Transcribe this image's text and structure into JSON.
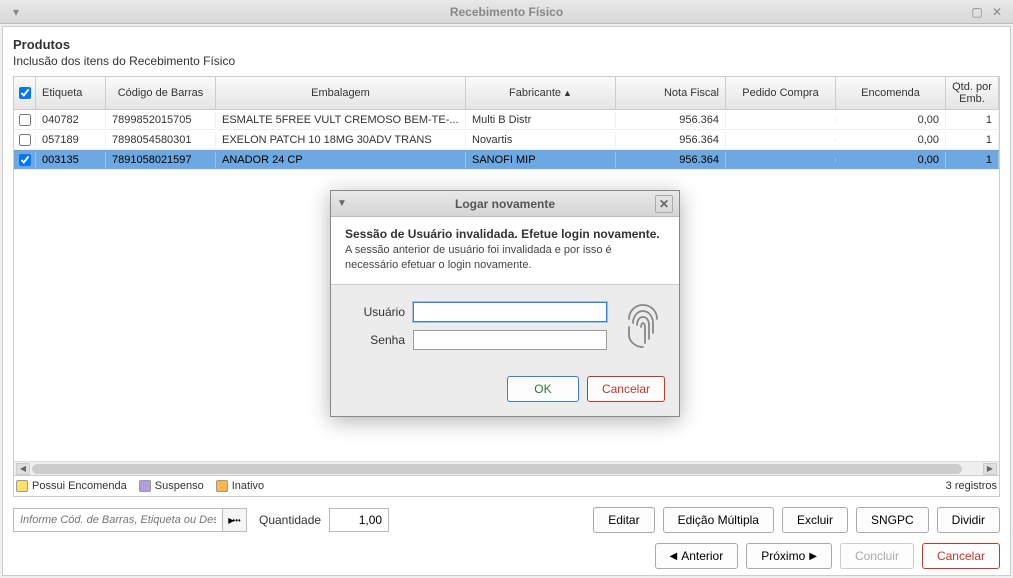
{
  "window": {
    "title": "Recebimento Físico"
  },
  "header": {
    "title": "Produtos",
    "subtitle": "Inclusão dos itens do Recebimento Físico"
  },
  "table": {
    "columns": {
      "etiqueta": "Etiqueta",
      "barras": "Código de Barras",
      "embalagem": "Embalagem",
      "fabricante": "Fabricante",
      "nota": "Nota Fiscal",
      "pedido": "Pedido Compra",
      "encomenda": "Encomenda",
      "qtd": "Qtd. por Emb."
    },
    "rows": [
      {
        "checked": false,
        "etiqueta": "040782",
        "barras": "7899852015705",
        "embalagem": "ESMALTE 5FREE VULT CREMOSO BEM-TE-...",
        "fabricante": "Multi B Distr",
        "nota": "956.364",
        "pedido": "",
        "encomenda": "0,00",
        "qtd": "1"
      },
      {
        "checked": false,
        "etiqueta": "057189",
        "barras": "7898054580301",
        "embalagem": "EXELON PATCH 10 18MG 30ADV TRANS",
        "fabricante": "Novartis",
        "nota": "956.364",
        "pedido": "",
        "encomenda": "0,00",
        "qtd": "1"
      },
      {
        "checked": true,
        "selected": true,
        "etiqueta": "003135",
        "barras": "7891058021597",
        "embalagem": "ANADOR 24 CP",
        "fabricante": "SANOFI MIP",
        "nota": "956.364",
        "pedido": "",
        "encomenda": "0,00",
        "qtd": "1"
      }
    ]
  },
  "legend": {
    "encomenda": "Possui Encomenda",
    "suspenso": "Suspenso",
    "inativo": "Inativo",
    "count": "3 registros"
  },
  "search": {
    "placeholder": "Informe Cód. de Barras, Etiqueta ou Des"
  },
  "qty": {
    "label": "Quantidade",
    "value": "1,00"
  },
  "buttons": {
    "editar": "Editar",
    "multipla": "Edição Múltipla",
    "excluir": "Excluir",
    "sngpc": "SNGPC",
    "dividir": "Dividir",
    "anterior": "Anterior",
    "proximo": "Próximo",
    "concluir": "Concluir",
    "cancelar": "Cancelar"
  },
  "modal": {
    "title": "Logar novamente",
    "heading": "Sessão de Usuário invalidada. Efetue login novamente.",
    "sub": "A sessão anterior de usuário foi invalidada e por isso é necessário efetuar o login novamente.",
    "user_label": "Usuário",
    "pass_label": "Senha",
    "ok": "OK",
    "cancel": "Cancelar"
  }
}
